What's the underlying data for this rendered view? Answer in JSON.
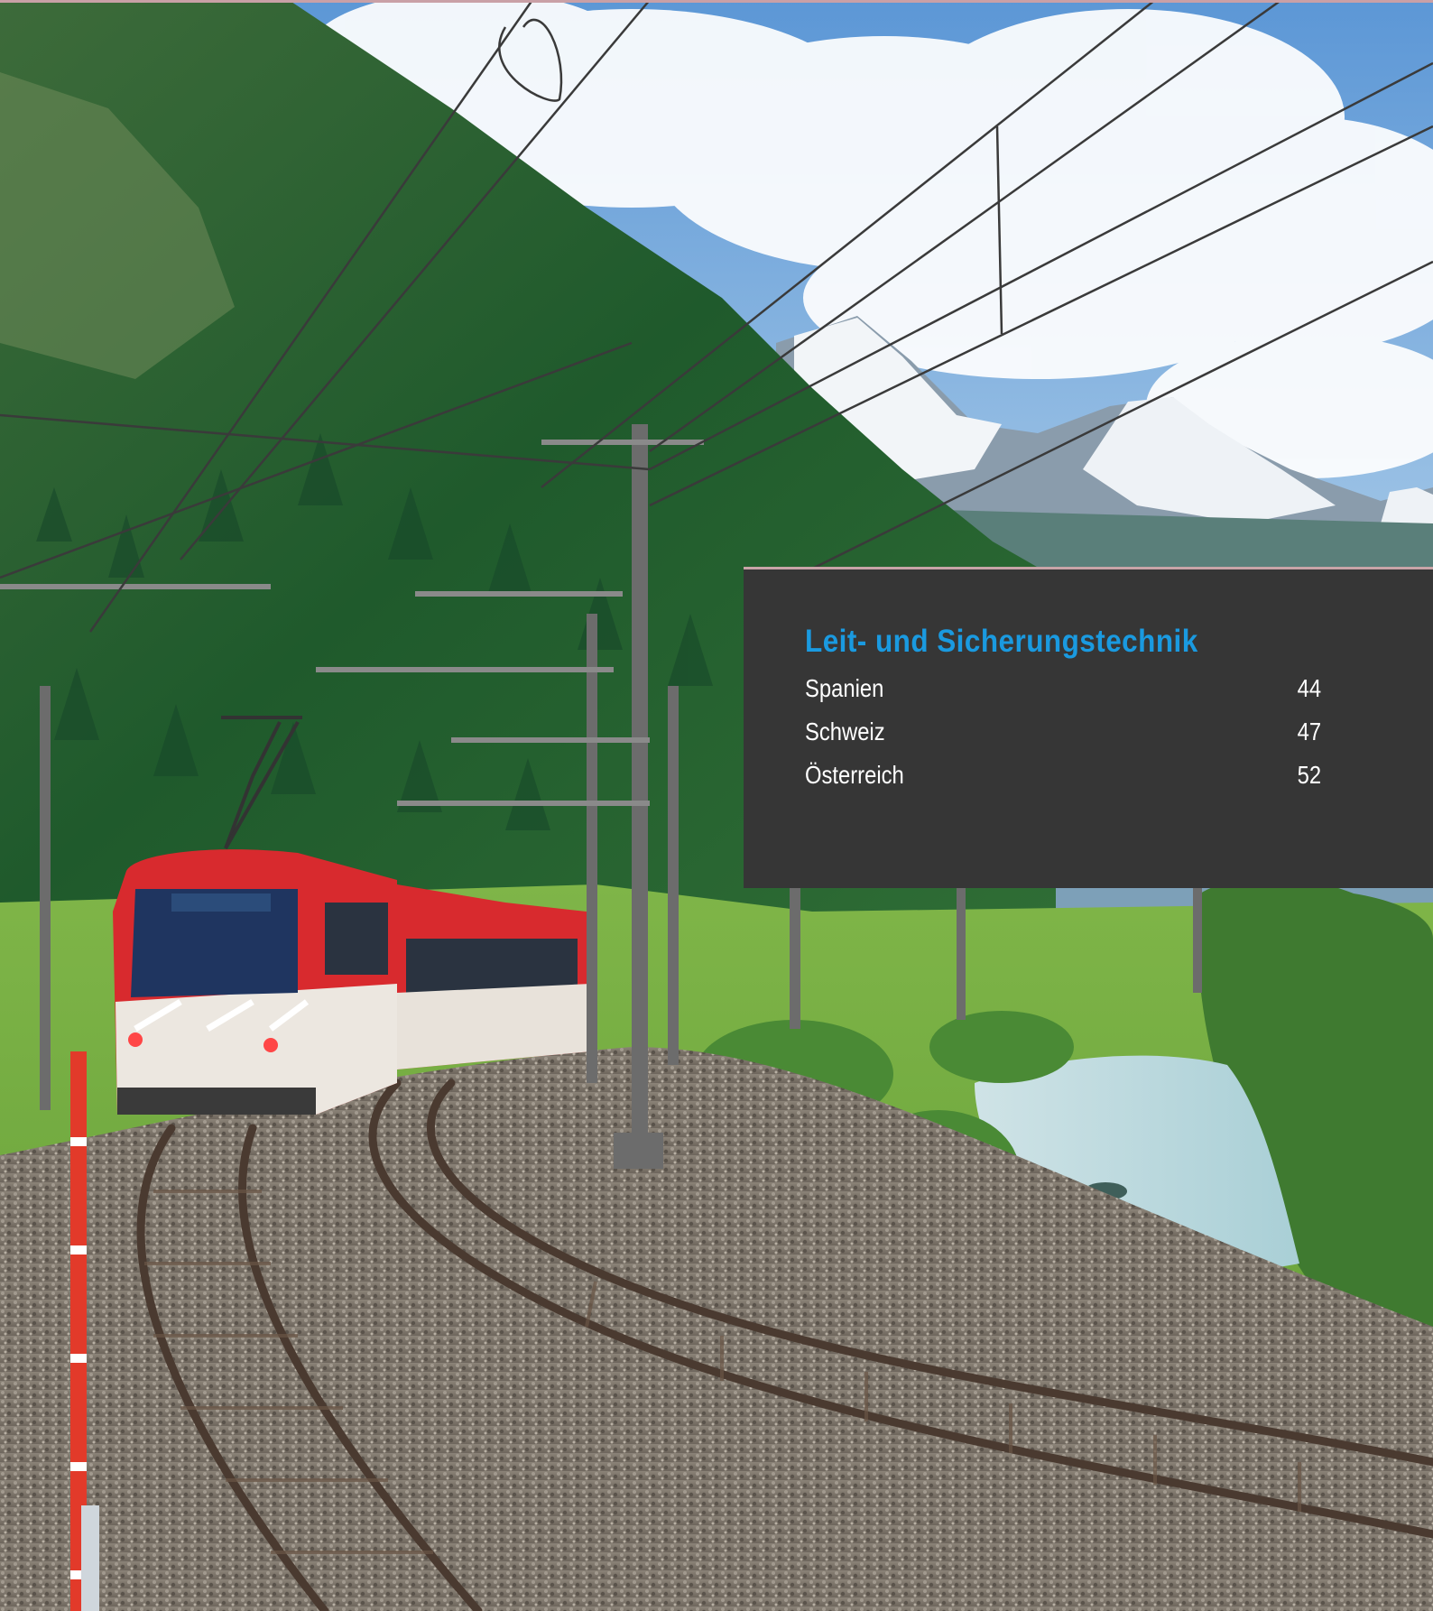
{
  "toc": {
    "heading": "Leit- und Sicherungstechnik",
    "entries": [
      {
        "label": "Spanien",
        "page": "44"
      },
      {
        "label": "Schweiz",
        "page": "47"
      },
      {
        "label": "Österreich",
        "page": "52"
      }
    ]
  },
  "colors": {
    "panel": "#363636",
    "heading": "#1a9ae0",
    "train_red": "#d82a2e",
    "accent_rule": "#c9a0a6"
  },
  "photo": {
    "icon": "alpine-railway-photo"
  }
}
